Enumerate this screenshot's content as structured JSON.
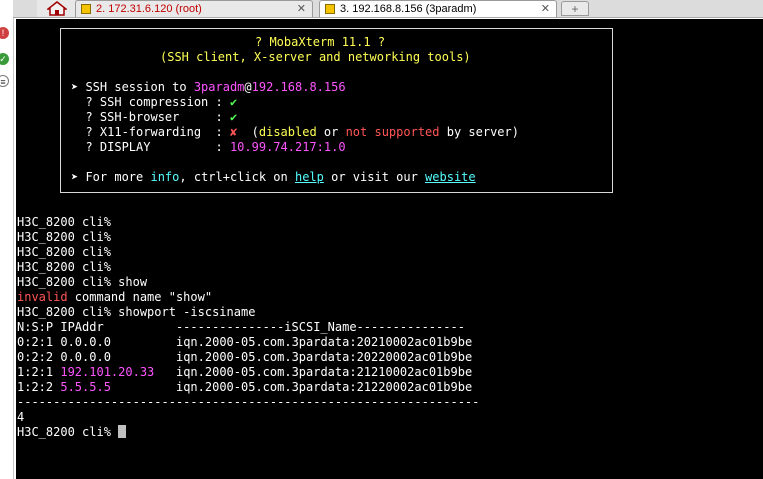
{
  "tabs": [
    {
      "label": "2. 172.31.6.120 (root)",
      "close": "✕"
    },
    {
      "label": "3. 192.168.8.156 (3paradm)",
      "close": "✕"
    }
  ],
  "new_tab": "+",
  "banner": {
    "title": "? MobaXterm 11.1 ?",
    "subtitle": "(SSH client, X-server and networking tools)",
    "session_prefix": "➤ SSH session to ",
    "session_user": "3paradm",
    "session_at": "@",
    "session_host": "192.168.8.156",
    "compression_label": "  ? SSH compression : ",
    "compression_value": "✔",
    "browser_label": "  ? SSH-browser     : ",
    "browser_value": "✔",
    "x11_label": "  ? X11-forwarding  : ",
    "x11_value": "✘",
    "x11_note_1": "  (",
    "x11_disabled": "disabled",
    "x11_or": " or ",
    "x11_notsup": "not supported",
    "x11_end": " by server)",
    "display_label": "  ? DISPLAY         : ",
    "display_value": "10.99.74.217:1.0",
    "more_prefix": "➤ For more ",
    "more_info": "info",
    "more_mid": ", ctrl+click on ",
    "more_help": "help",
    "more_mid2": " or visit our ",
    "more_website": "website"
  },
  "terminal": {
    "prompt_lines": [
      "H3C_8200 cli%",
      "H3C_8200 cli%",
      "H3C_8200 cli%",
      "H3C_8200 cli%"
    ],
    "show_cmd": "H3C_8200 cli% show",
    "err_invalid": "invalid",
    "err_rest": " command name \"show\"",
    "showport_cmd": "H3C_8200 cli% showport -iscsiname",
    "header": "N:S:P IPAddr          ---------------iSCSI_Name---------------",
    "rows": [
      {
        "nsp": "0:2:1 ",
        "ip": "0.0.0.0",
        "pad": "         ",
        "iqn": "iqn.2000-05.com.3pardata:20210002ac01b9be"
      },
      {
        "nsp": "0:2:2 ",
        "ip": "0.0.0.0",
        "pad": "         ",
        "iqn": "iqn.2000-05.com.3pardata:20220002ac01b9be"
      },
      {
        "nsp": "1:2:1 ",
        "ip": "192.101.20.33",
        "pad": "   ",
        "iqn": "iqn.2000-05.com.3pardata:21210002ac01b9be"
      },
      {
        "nsp": "1:2:2 ",
        "ip": "5.5.5.5",
        "pad": "         ",
        "iqn": "iqn.2000-05.com.3pardata:21220002ac01b9be"
      }
    ],
    "separator": "----------------------------------------------------------------",
    "count": "4",
    "final_prompt": "H3C_8200 cli% "
  }
}
